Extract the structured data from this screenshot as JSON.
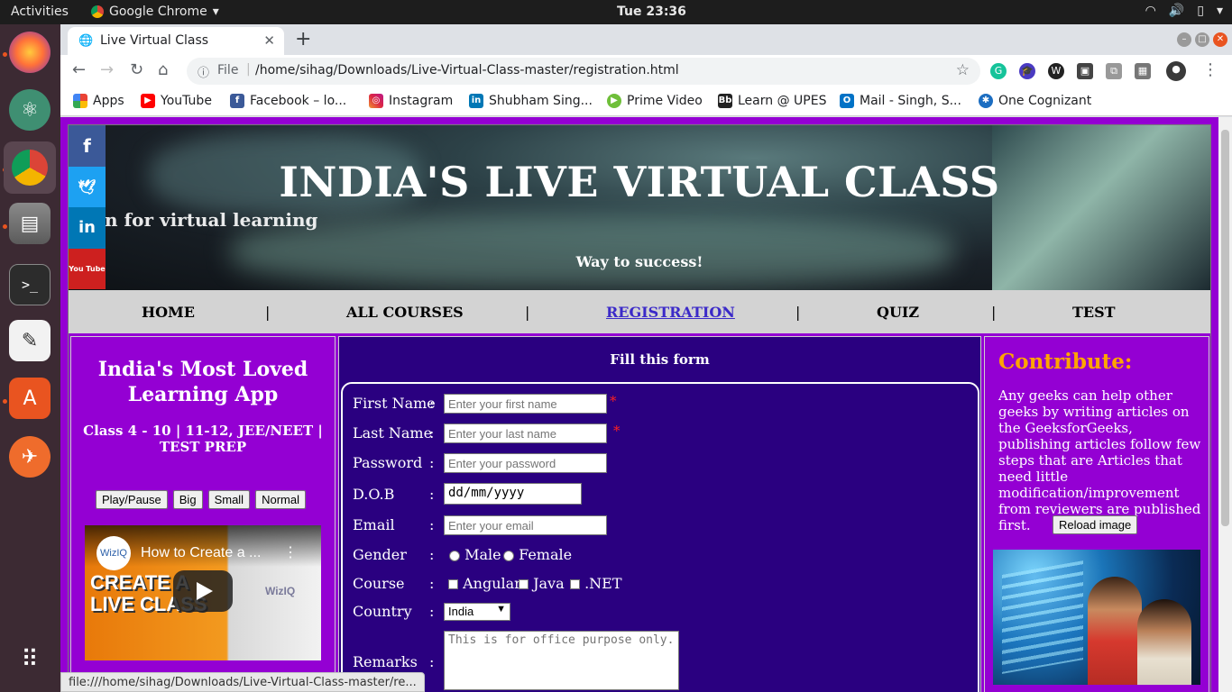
{
  "topbar": {
    "activities": "Activities",
    "app_name": "Google Chrome",
    "clock": "Tue 23:36"
  },
  "chrome": {
    "tab_title": "Live Virtual Class",
    "omnibox_scheme": "File",
    "url": "/home/sihag/Downloads/Live-Virtual-Class-master/registration.html",
    "bookmarks": [
      {
        "label": "Apps",
        "icon": "apps-grid-icon",
        "color": "#4285f4"
      },
      {
        "label": "YouTube",
        "icon": "youtube-icon",
        "color": "#ff0000"
      },
      {
        "label": "Facebook – lo...",
        "icon": "facebook-icon",
        "color": "#3b5998"
      },
      {
        "label": "Instagram",
        "icon": "instagram-icon",
        "color": "#d6249f"
      },
      {
        "label": "Shubham Sing...",
        "icon": "linkedin-icon",
        "color": "#0077b5"
      },
      {
        "label": "Prime Video",
        "icon": "prime-video-icon",
        "color": "#6fbf3a"
      },
      {
        "label": "Learn @ UPES",
        "icon": "blackboard-icon",
        "color": "#222222"
      },
      {
        "label": "Mail - Singh, S...",
        "icon": "outlook-icon",
        "color": "#0072c6"
      },
      {
        "label": "One Cognizant",
        "icon": "cognizant-icon",
        "color": "#1b6dc1"
      }
    ],
    "status_url": "file:///home/sihag/Downloads/Live-Virtual-Class-master/re..."
  },
  "page": {
    "banner_title": "INDIA'S LIVE VIRTUAL CLASS",
    "marquee_text": "n for virtual learning",
    "tagline": "Way to success!",
    "social": [
      {
        "label": "f",
        "icon": "facebook-icon",
        "color": "#3b5998"
      },
      {
        "label": "🐦",
        "icon": "twitter-icon",
        "color": "#1da1f2"
      },
      {
        "label": "in",
        "icon": "linkedin-icon",
        "color": "#0077b5"
      },
      {
        "label": "You Tube",
        "icon": "youtube-icon",
        "color": "#cd201f"
      }
    ],
    "nav": {
      "home": "HOME",
      "courses": "ALL COURSES",
      "registration": "REGISTRATION",
      "quiz": "QUIZ",
      "test": "TEST",
      "separator": "|"
    },
    "left": {
      "heading": "India's Most Loved Learning App",
      "classes": "Class 4 - 10 | 11-12, JEE/NEET | TEST PREP",
      "buttons": [
        "Play/Pause",
        "Big",
        "Small",
        "Normal"
      ],
      "video_title": "How to Create a ...",
      "video_logo": "WizIQ",
      "video_overlay": "CREATE A\nLIVE CLASS",
      "video_watermark": "WizIQ"
    },
    "form": {
      "heading": "Fill this form",
      "first_name_label": "First Name",
      "first_name_placeholder": "Enter your first name",
      "last_name_label": "Last Name",
      "last_name_placeholder": "Enter your last name",
      "password_label": "Password",
      "password_placeholder": "Enter your password",
      "dob_label": "D.O.B",
      "dob_value": "dd/mm/yyyy",
      "email_label": "Email",
      "email_placeholder": "Enter your email",
      "gender_label": "Gender",
      "gender_options": [
        "Male",
        "Female"
      ],
      "course_label": "Course",
      "course_options": [
        "Angular",
        "Java",
        ".NET"
      ],
      "country_label": "Country",
      "country_value": "India",
      "remarks_label": "Remarks",
      "remarks_value": "This is for office purpose only.",
      "colon": ":",
      "required_mark": "*"
    },
    "right": {
      "heading": "Contribute:",
      "text": "Any geeks can help other geeks by writing articles on the GeeksforGeeks, publishing articles follow few steps that are Articles that need little modification/improvement from reviewers are published first.",
      "reload_button": "Reload image"
    }
  },
  "colors": {
    "page_bg": "#9400d3",
    "form_bg": "#2a0080",
    "contribute_heading": "#ffa500",
    "active_nav": "#3b2ac8"
  }
}
